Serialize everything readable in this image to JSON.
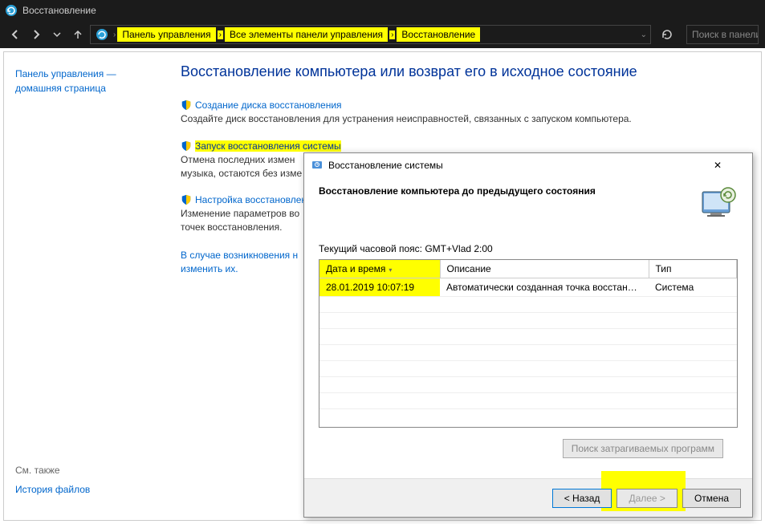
{
  "window": {
    "title": "Восстановление"
  },
  "breadcrumb": {
    "items": [
      "Панель управления",
      "Все элементы панели управления",
      "Восстановление"
    ]
  },
  "search": {
    "placeholder": "Поиск в панели"
  },
  "sidebar": {
    "home_line1": "Панель управления —",
    "home_line2": "домашняя страница",
    "see_also_label": "См. также",
    "see_also_link": "История файлов"
  },
  "main": {
    "heading": "Восстановление компьютера или возврат его в исходное состояние",
    "items": [
      {
        "link": "Создание диска восстановления",
        "desc": "Создайте диск восстановления для устранения неисправностей, связанных с запуском компьютера.",
        "highlight": false
      },
      {
        "link": "Запуск восстановления системы",
        "desc": "Отмена последних изменений системы, которые могут замедлять работу компьютера. Ваши документы, музыка, остаются без изменений.",
        "highlight": true
      },
      {
        "link": "Настройка восстановления",
        "desc": "Изменение параметров восстановления, управление дисковым пространством и создание или удаление точек восстановления.",
        "highlight": false
      }
    ],
    "footer_text": "В случае возникновения неполадок с компьютером перейдите в параметры и попробуйте изменить их.",
    "footer_link_prefix": "В случае возникновения н",
    "footer_link_suffix": "изменить их."
  },
  "dialog": {
    "title": "Восстановление системы",
    "header_text": "Восстановление компьютера до предыдущего состояния",
    "timezone_label": "Текущий часовой пояс: GMT+Vlad 2:00",
    "columns": {
      "datetime": "Дата и время",
      "description": "Описание",
      "type": "Тип"
    },
    "rows": [
      {
        "datetime": "28.01.2019 10:07:19",
        "description": "Автоматически созданная точка восстановле...",
        "type": "Система"
      }
    ],
    "search_affected_btn": "Поиск затрагиваемых программ",
    "back_btn": "< Назад",
    "next_btn": "Далее >",
    "cancel_btn": "Отмена"
  }
}
